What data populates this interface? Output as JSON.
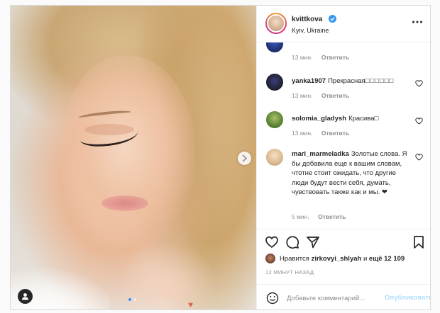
{
  "post": {
    "username": "kvittkova",
    "location": "Kyiv, Ukraine",
    "image_indicator": {
      "count": 2,
      "active": 1
    }
  },
  "comments": [
    {
      "user": "",
      "text": "",
      "time": "13 мин.",
      "reply": "Ответить",
      "avatar_color": "#2a3f8f"
    },
    {
      "user": "yanka1907",
      "text": "Прекрасная",
      "time": "13 мин.",
      "reply": "Ответить",
      "avatar_color": "#2b2b3a"
    },
    {
      "user": "solomia_gladysh",
      "text": "Красива",
      "time": "13 мин.",
      "reply": "Ответить",
      "avatar_color": "#6b8e3a"
    },
    {
      "user": "mari_marmeladka",
      "text": "Золотые слова. Я бы добавила еще к вашим словам, чтотне стоит ожидать, что другие люди будут вести себя, думать, чувствовать также как и мы. ❤",
      "time": "5 мин.",
      "reply": "Ответить",
      "avatar_color": "#e6c9a0"
    }
  ],
  "likes": {
    "prefix": "Нравится",
    "user": "zirkovyi_shlyah",
    "middle": "и",
    "others": "ещё 12 109"
  },
  "timestamp": "12 МИНУТ НАЗАД",
  "comment_box": {
    "placeholder": "Добавьте комментарий...",
    "publish_label": "Опубликовать"
  },
  "icons": {
    "verified": "verified-badge-icon",
    "more": "more-options-icon",
    "like": "heart-icon",
    "comment": "comment-icon",
    "share": "share-icon",
    "save": "bookmark-icon",
    "emoji": "emoji-icon",
    "next": "chevron-right-icon",
    "tag": "user-tag-icon"
  },
  "colors": {
    "accent": "#3897f0",
    "publish_disabled": "#b2dffc",
    "meta_text": "#8e8e8e"
  }
}
